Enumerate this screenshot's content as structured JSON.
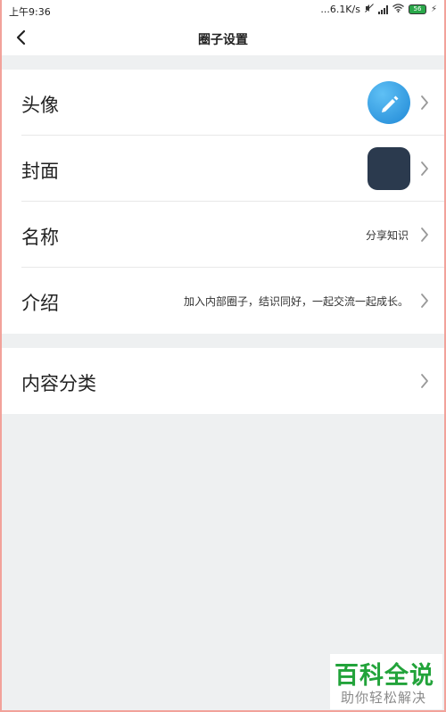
{
  "status_bar": {
    "time": "上午9:36",
    "speed": "...6.1K/s",
    "battery": "56"
  },
  "nav": {
    "title": "圈子设置"
  },
  "rows": [
    {
      "label": "头像",
      "value": ""
    },
    {
      "label": "封面",
      "value": ""
    },
    {
      "label": "名称",
      "value": "分享知识"
    },
    {
      "label": "介绍",
      "value": "加入内部圈子，结识同好，一起交流一起成长。"
    }
  ],
  "section2": {
    "label": "内容分类"
  },
  "colors": {
    "accent_blue": "#2a8fe0",
    "cover_fill": "#2b3a4e",
    "page_bg": "#eef0f1",
    "watermark_green": "#22a33a"
  },
  "watermark": {
    "brand": "百科全说",
    "tagline": "助你轻松解决"
  }
}
